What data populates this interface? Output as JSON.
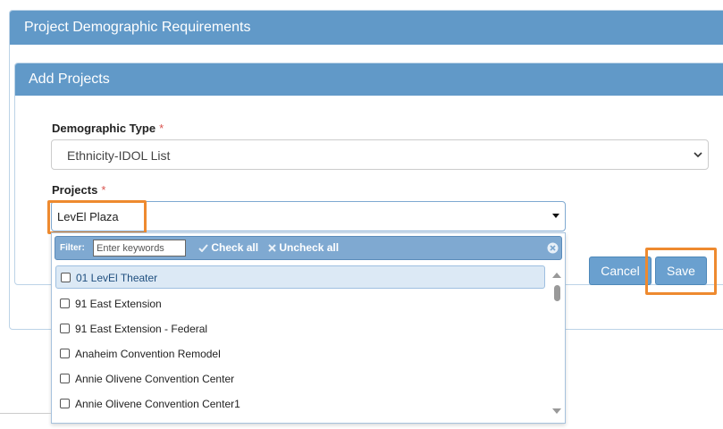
{
  "page_title": "Project Demographic Requirements",
  "panel_title": "Add Projects",
  "demographic_type": {
    "label": "Demographic Type",
    "required": "*",
    "selected": "Ethnicity-IDOL List"
  },
  "projects": {
    "label": "Projects",
    "required": "*",
    "selected": "LevEl Plaza"
  },
  "filter": {
    "label": "Filter:",
    "placeholder": "Enter keywords",
    "check_all": "Check all",
    "uncheck_all": "Uncheck all"
  },
  "project_options": [
    "01 LevEl Theater",
    "91 East Extension",
    "91 East Extension - Federal",
    "Anaheim Convention Remodel",
    "Annie Olivene Convention Center",
    "Annie Olivene Convention Center1"
  ],
  "buttons": {
    "cancel": "Cancel",
    "save": "Save"
  },
  "colors": {
    "header": "#6199c8",
    "button": "#6aa0cf",
    "highlight": "#ee8a2f",
    "required": "#d9534f"
  }
}
